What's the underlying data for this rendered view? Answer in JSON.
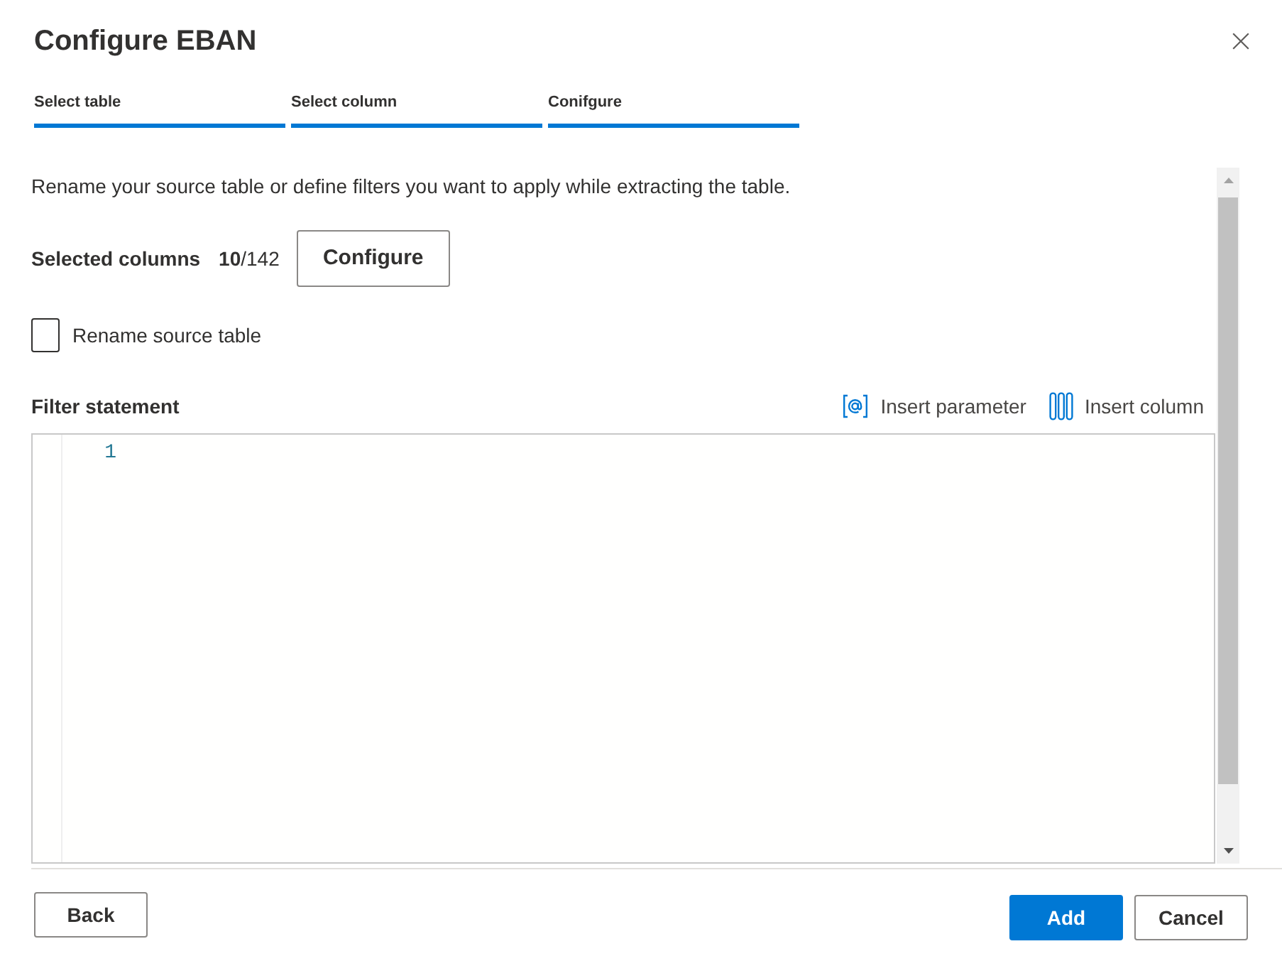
{
  "dialog": {
    "title": "Configure EBAN"
  },
  "steps": [
    {
      "label": "Select table",
      "completed": true
    },
    {
      "label": "Select column",
      "completed": true
    },
    {
      "label": "Conifgure",
      "completed": true
    }
  ],
  "description": "Rename your source table or define filters you want to apply while extracting the table.",
  "selected_columns": {
    "label": "Selected columns",
    "count": "**10**/142",
    "button": "Configure"
  },
  "rename_source_table": {
    "label": "Rename source table",
    "checked": false
  },
  "filter_statement": {
    "label": "Filter statement",
    "actions": [
      {
        "kind": "parameter",
        "label": "Insert parameter"
      },
      {
        "kind": "column",
        "label": "Insert column"
      }
    ],
    "editor": {
      "line_numbers": [
        "1"
      ]
    }
  },
  "footer": {
    "left_buttons": [
      {
        "label": "Back",
        "primary": false
      }
    ],
    "right_buttons": [
      {
        "label": "Add",
        "primary": true
      },
      {
        "label": "Cancel",
        "primary": false
      }
    ]
  }
}
